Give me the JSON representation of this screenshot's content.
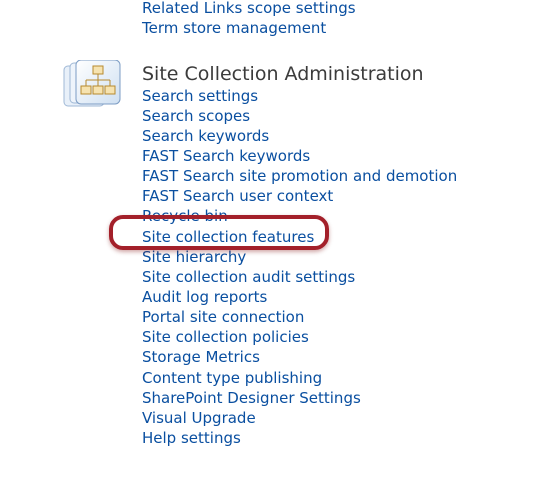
{
  "top_links": [
    "Related Links scope settings",
    "Term store management"
  ],
  "section": {
    "title": "Site Collection Administration",
    "icon": "site-hierarchy-icon",
    "links": [
      "Search settings",
      "Search scopes",
      "Search keywords",
      "FAST Search keywords",
      "FAST Search site promotion and demotion",
      "FAST Search user context",
      "Recycle bin",
      "Site collection features",
      "Site hierarchy",
      "Site collection audit settings",
      "Audit log reports",
      "Portal site connection",
      "Site collection policies",
      "Storage Metrics",
      "Content type publishing",
      "SharePoint Designer Settings",
      "Visual Upgrade",
      "Help settings"
    ],
    "highlighted_link": "Site collection features"
  },
  "colors": {
    "link": "#0a4fa0",
    "heading": "#3b3b3b",
    "highlight": "#a3202a"
  }
}
